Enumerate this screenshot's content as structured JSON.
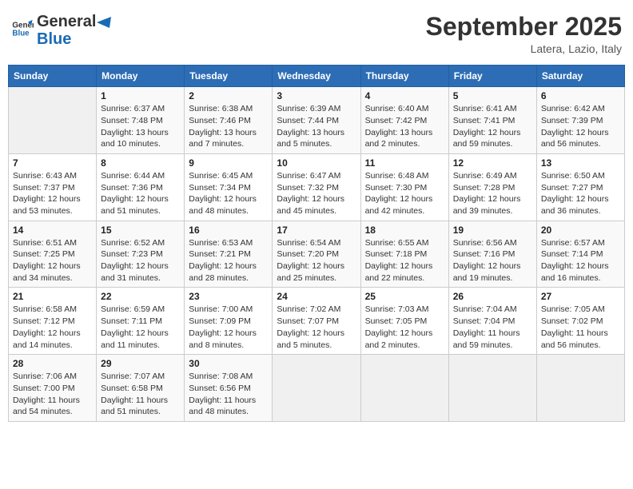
{
  "header": {
    "logo_line1": "General",
    "logo_line2": "Blue",
    "month_year": "September 2025",
    "location": "Latera, Lazio, Italy"
  },
  "days_of_week": [
    "Sunday",
    "Monday",
    "Tuesday",
    "Wednesday",
    "Thursday",
    "Friday",
    "Saturday"
  ],
  "weeks": [
    [
      {
        "day": "",
        "sunrise": "",
        "sunset": "",
        "daylight": "",
        "empty": true
      },
      {
        "day": "1",
        "sunrise": "Sunrise: 6:37 AM",
        "sunset": "Sunset: 7:48 PM",
        "daylight": "Daylight: 13 hours and 10 minutes."
      },
      {
        "day": "2",
        "sunrise": "Sunrise: 6:38 AM",
        "sunset": "Sunset: 7:46 PM",
        "daylight": "Daylight: 13 hours and 7 minutes."
      },
      {
        "day": "3",
        "sunrise": "Sunrise: 6:39 AM",
        "sunset": "Sunset: 7:44 PM",
        "daylight": "Daylight: 13 hours and 5 minutes."
      },
      {
        "day": "4",
        "sunrise": "Sunrise: 6:40 AM",
        "sunset": "Sunset: 7:42 PM",
        "daylight": "Daylight: 13 hours and 2 minutes."
      },
      {
        "day": "5",
        "sunrise": "Sunrise: 6:41 AM",
        "sunset": "Sunset: 7:41 PM",
        "daylight": "Daylight: 12 hours and 59 minutes."
      },
      {
        "day": "6",
        "sunrise": "Sunrise: 6:42 AM",
        "sunset": "Sunset: 7:39 PM",
        "daylight": "Daylight: 12 hours and 56 minutes."
      }
    ],
    [
      {
        "day": "7",
        "sunrise": "Sunrise: 6:43 AM",
        "sunset": "Sunset: 7:37 PM",
        "daylight": "Daylight: 12 hours and 53 minutes."
      },
      {
        "day": "8",
        "sunrise": "Sunrise: 6:44 AM",
        "sunset": "Sunset: 7:36 PM",
        "daylight": "Daylight: 12 hours and 51 minutes."
      },
      {
        "day": "9",
        "sunrise": "Sunrise: 6:45 AM",
        "sunset": "Sunset: 7:34 PM",
        "daylight": "Daylight: 12 hours and 48 minutes."
      },
      {
        "day": "10",
        "sunrise": "Sunrise: 6:47 AM",
        "sunset": "Sunset: 7:32 PM",
        "daylight": "Daylight: 12 hours and 45 minutes."
      },
      {
        "day": "11",
        "sunrise": "Sunrise: 6:48 AM",
        "sunset": "Sunset: 7:30 PM",
        "daylight": "Daylight: 12 hours and 42 minutes."
      },
      {
        "day": "12",
        "sunrise": "Sunrise: 6:49 AM",
        "sunset": "Sunset: 7:28 PM",
        "daylight": "Daylight: 12 hours and 39 minutes."
      },
      {
        "day": "13",
        "sunrise": "Sunrise: 6:50 AM",
        "sunset": "Sunset: 7:27 PM",
        "daylight": "Daylight: 12 hours and 36 minutes."
      }
    ],
    [
      {
        "day": "14",
        "sunrise": "Sunrise: 6:51 AM",
        "sunset": "Sunset: 7:25 PM",
        "daylight": "Daylight: 12 hours and 34 minutes."
      },
      {
        "day": "15",
        "sunrise": "Sunrise: 6:52 AM",
        "sunset": "Sunset: 7:23 PM",
        "daylight": "Daylight: 12 hours and 31 minutes."
      },
      {
        "day": "16",
        "sunrise": "Sunrise: 6:53 AM",
        "sunset": "Sunset: 7:21 PM",
        "daylight": "Daylight: 12 hours and 28 minutes."
      },
      {
        "day": "17",
        "sunrise": "Sunrise: 6:54 AM",
        "sunset": "Sunset: 7:20 PM",
        "daylight": "Daylight: 12 hours and 25 minutes."
      },
      {
        "day": "18",
        "sunrise": "Sunrise: 6:55 AM",
        "sunset": "Sunset: 7:18 PM",
        "daylight": "Daylight: 12 hours and 22 minutes."
      },
      {
        "day": "19",
        "sunrise": "Sunrise: 6:56 AM",
        "sunset": "Sunset: 7:16 PM",
        "daylight": "Daylight: 12 hours and 19 minutes."
      },
      {
        "day": "20",
        "sunrise": "Sunrise: 6:57 AM",
        "sunset": "Sunset: 7:14 PM",
        "daylight": "Daylight: 12 hours and 16 minutes."
      }
    ],
    [
      {
        "day": "21",
        "sunrise": "Sunrise: 6:58 AM",
        "sunset": "Sunset: 7:12 PM",
        "daylight": "Daylight: 12 hours and 14 minutes."
      },
      {
        "day": "22",
        "sunrise": "Sunrise: 6:59 AM",
        "sunset": "Sunset: 7:11 PM",
        "daylight": "Daylight: 12 hours and 11 minutes."
      },
      {
        "day": "23",
        "sunrise": "Sunrise: 7:00 AM",
        "sunset": "Sunset: 7:09 PM",
        "daylight": "Daylight: 12 hours and 8 minutes."
      },
      {
        "day": "24",
        "sunrise": "Sunrise: 7:02 AM",
        "sunset": "Sunset: 7:07 PM",
        "daylight": "Daylight: 12 hours and 5 minutes."
      },
      {
        "day": "25",
        "sunrise": "Sunrise: 7:03 AM",
        "sunset": "Sunset: 7:05 PM",
        "daylight": "Daylight: 12 hours and 2 minutes."
      },
      {
        "day": "26",
        "sunrise": "Sunrise: 7:04 AM",
        "sunset": "Sunset: 7:04 PM",
        "daylight": "Daylight: 11 hours and 59 minutes."
      },
      {
        "day": "27",
        "sunrise": "Sunrise: 7:05 AM",
        "sunset": "Sunset: 7:02 PM",
        "daylight": "Daylight: 11 hours and 56 minutes."
      }
    ],
    [
      {
        "day": "28",
        "sunrise": "Sunrise: 7:06 AM",
        "sunset": "Sunset: 7:00 PM",
        "daylight": "Daylight: 11 hours and 54 minutes."
      },
      {
        "day": "29",
        "sunrise": "Sunrise: 7:07 AM",
        "sunset": "Sunset: 6:58 PM",
        "daylight": "Daylight: 11 hours and 51 minutes."
      },
      {
        "day": "30",
        "sunrise": "Sunrise: 7:08 AM",
        "sunset": "Sunset: 6:56 PM",
        "daylight": "Daylight: 11 hours and 48 minutes."
      },
      {
        "day": "",
        "sunrise": "",
        "sunset": "",
        "daylight": "",
        "empty": true
      },
      {
        "day": "",
        "sunrise": "",
        "sunset": "",
        "daylight": "",
        "empty": true
      },
      {
        "day": "",
        "sunrise": "",
        "sunset": "",
        "daylight": "",
        "empty": true
      },
      {
        "day": "",
        "sunrise": "",
        "sunset": "",
        "daylight": "",
        "empty": true
      }
    ]
  ]
}
